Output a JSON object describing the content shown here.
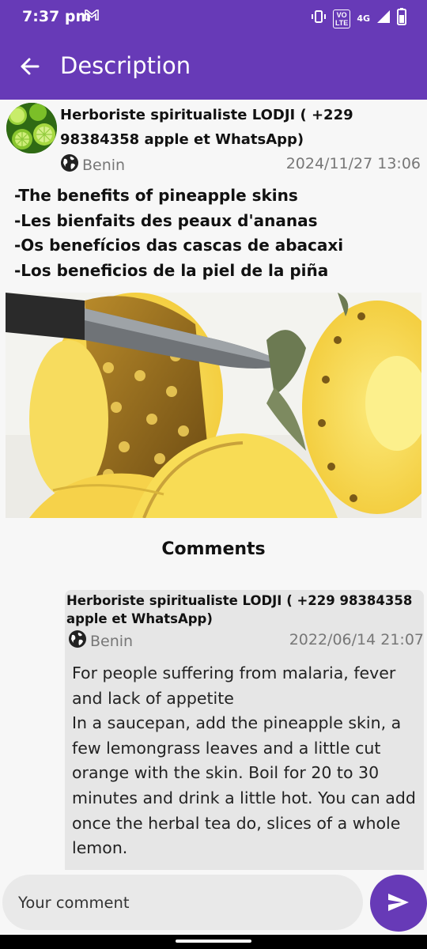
{
  "status_bar": {
    "time": "7:37 pm",
    "lte": "VO\nLTE",
    "network": "4G",
    "icons": [
      "gmail-icon",
      "vibrate-icon",
      "signal-icon",
      "battery-icon"
    ]
  },
  "app_bar": {
    "title": "Description",
    "back_icon": "arrow-back-icon",
    "color": "#673ab7"
  },
  "post": {
    "author": "Herboriste spiritualiste LODJI ( +229 98384358 apple et WhatsApp)",
    "location": "Benin",
    "date": "2024/11/27 13:06",
    "lines": [
      "-The benefits of pineapple skins",
      "-Les bienfaits des peaux d'ananas",
      "-Os benefícios das cascas de abacaxi",
      "-Los beneficios de la piel de la piña"
    ]
  },
  "comments": {
    "title": "Comments",
    "items": [
      {
        "author": "Herboriste spiritualiste LODJI ( +229 98384358 apple et WhatsApp)",
        "location": "Benin",
        "date": "2022/06/14 21:07",
        "body": "For people suffering from malaria, fever and lack of appetite\nIn a saucepan, add the pineapple skin, a few lemongrass leaves and a little cut orange with the skin. Boil for 20 to 30 minutes and drink a little hot. You can add once the herbal tea do, slices of a whole lemon."
      }
    ]
  },
  "composer": {
    "placeholder": "Your comment",
    "send_icon": "send-icon"
  }
}
